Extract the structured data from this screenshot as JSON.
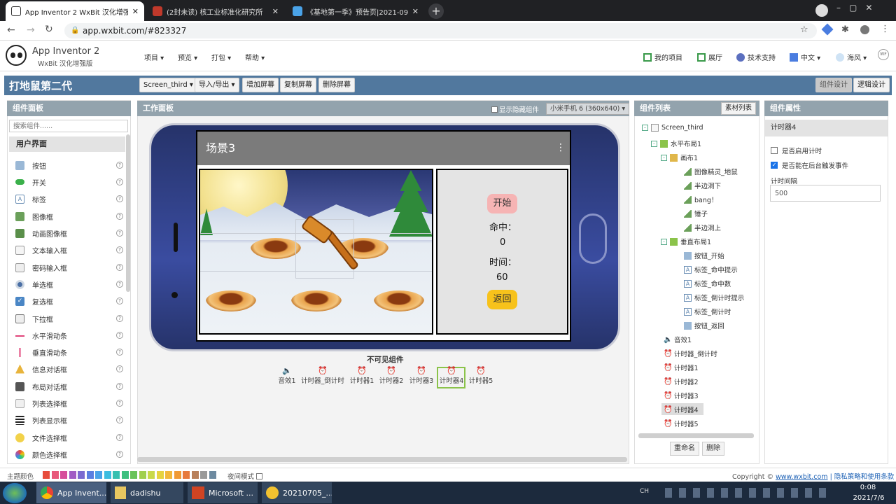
{
  "browser": {
    "tabs": [
      {
        "label": "App Inventor 2 WxBit 汉化增强",
        "active": true
      },
      {
        "label": "(2封未读) 核工业标准化研究所",
        "active": false
      },
      {
        "label": "《基地第一季》预告页|2021-09",
        "active": false
      }
    ],
    "new_tab": "+",
    "close": "✕",
    "url": "app.wxbit.com/#823327"
  },
  "app": {
    "title": "App Inventor 2",
    "subtitle": "WxBit 汉化增强版",
    "menus": [
      "项目 ▾",
      "预览 ▾",
      "打包 ▾",
      "帮助 ▾"
    ],
    "right_links": [
      "我的项目",
      "展厅",
      "技术支持",
      "中文 ▾",
      "海风 ▾"
    ]
  },
  "screenbar": {
    "project": "打地鼠第二代",
    "screen_select": "Screen_third ▾",
    "buttons": [
      "导入/导出 ▾",
      "增加屏幕",
      "复制屏幕",
      "删除屏幕"
    ],
    "mode_buttons": [
      "组件设计",
      "逻辑设计"
    ]
  },
  "palette": {
    "title": "组件面板",
    "search_placeholder": "搜索组件......",
    "category": "用户界面",
    "items": [
      "按钮",
      "开关",
      "标签",
      "图像框",
      "动画图像框",
      "文本输入框",
      "密码输入框",
      "单选框",
      "复选框",
      "下拉框",
      "水平滑动条",
      "垂直滑动条",
      "信息对话框",
      "布局对话框",
      "列表选择框",
      "列表显示框",
      "文件选择框",
      "颜色选择框"
    ],
    "help": "?"
  },
  "viewer": {
    "title": "工作面板",
    "show_hidden": "显示隐藏组件",
    "device": "小米手机 6 (360x640) ▾",
    "screen_title": "场景3",
    "start_btn": "开始",
    "hit_label": "命中：",
    "hit_value": "0",
    "time_label": "时间：",
    "time_value": "60",
    "back_btn": "返回",
    "menu_dots": "⋮",
    "invisible_title": "不可见组件",
    "invisible": [
      "音效1",
      "计时器_倒计时",
      "计时器1",
      "计时器2",
      "计时器3",
      "计时器4",
      "计时器5"
    ]
  },
  "components": {
    "title": "组件列表",
    "assets_btn": "素材列表",
    "tree": [
      "Screen_third",
      "水平布局1",
      "画布1",
      "图像精灵_地鼠",
      "半边洞下",
      "bang！",
      "锤子",
      "半边洞上",
      "垂直布局1",
      "按钮_开始",
      "标签_命中提示",
      "标签_命中数",
      "标签_倒计时提示",
      "标签_倒计时",
      "按钮_返回",
      "音效1",
      "计时器_倒计时",
      "计时器1",
      "计时器2",
      "计时器3",
      "计时器4",
      "计时器5"
    ],
    "rename": "重命名",
    "delete": "删除"
  },
  "properties": {
    "title": "组件属性",
    "component": "计时器4",
    "enabled_label": "是否启用计时",
    "background_label": "是否能在后台触发事件",
    "interval_label": "计时间隔",
    "interval_value": "500"
  },
  "footer": {
    "theme": "主题颜色",
    "night": "夜间模式",
    "copyright": "Copyright © ",
    "site": "www.wxbit.com",
    "privacy": "| 隐私策略和使用条款",
    "swatches": [
      "#e74c3c",
      "#e8587a",
      "#d64e9b",
      "#a05bc4",
      "#7b6ad0",
      "#5b7fe0",
      "#4aa3e8",
      "#3cbde0",
      "#34c0b0",
      "#3cbf7e",
      "#69c35a",
      "#a0cf4e",
      "#c9d94a",
      "#e6d341",
      "#f2b83c",
      "#f09a35",
      "#e7793b",
      "#b8805a",
      "#9a9a9a",
      "#6d8aa0"
    ]
  },
  "taskbar": {
    "items": [
      "App Invent...",
      "dadishu",
      "Microsoft ...",
      "20210705_..."
    ],
    "time": "0:08",
    "date": "2021/7/6",
    "ime": "CH"
  }
}
